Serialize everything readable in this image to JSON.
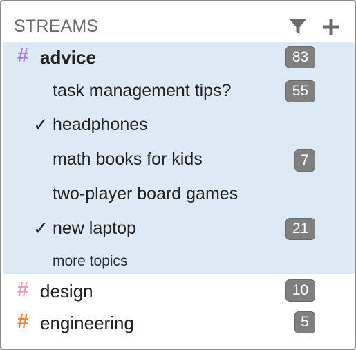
{
  "header": {
    "title": "STREAMS",
    "filter_icon": "filter-icon",
    "add_icon": "plus-icon"
  },
  "streams": [
    {
      "name": "advice",
      "unread": "83",
      "hash_color": "#b07be0",
      "active": true,
      "topics": [
        {
          "name": "task management tips?",
          "unread": "55",
          "checked": false
        },
        {
          "name": "headphones",
          "unread": "",
          "checked": true
        },
        {
          "name": "math books for kids",
          "unread": "7",
          "checked": false
        },
        {
          "name": "two-player board games",
          "unread": "",
          "checked": false
        },
        {
          "name": "new laptop",
          "unread": "21",
          "checked": true
        }
      ],
      "more_topics": "more topics"
    },
    {
      "name": "design",
      "unread": "10",
      "hash_color": "#e99bb8",
      "active": false
    },
    {
      "name": "engineering",
      "unread": "5",
      "hash_color": "#f0813d",
      "active": false
    }
  ],
  "check_glyph": "✓",
  "hash_glyph": "#",
  "colors": {
    "active_background": "#dde9f4",
    "badge_background": "#808080",
    "border": "#8a8a8a"
  }
}
